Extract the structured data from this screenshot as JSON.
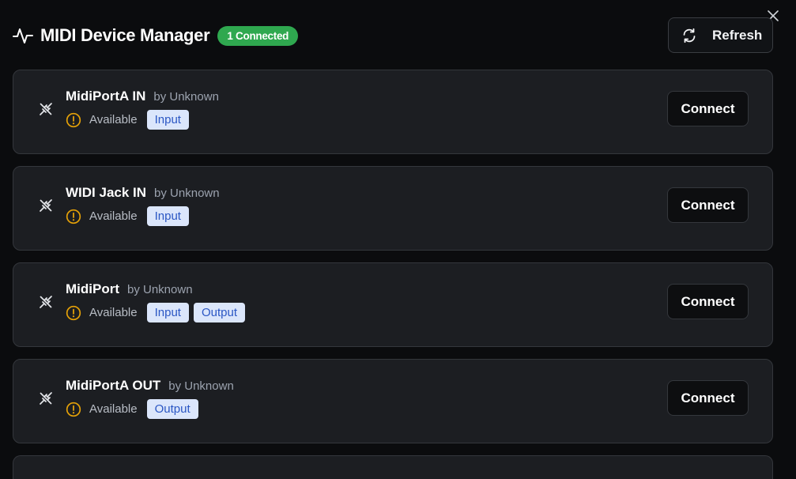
{
  "window": {
    "title": "MIDI Device Manager",
    "connected_badge": "1 Connected",
    "refresh_label": "Refresh",
    "close_icon": "close-icon",
    "title_icon": "activity-pulse-icon"
  },
  "colors": {
    "background": "#0b0c0e",
    "card": "#1c1e22",
    "badge_green": "#2fa84f",
    "warning": "#e3a008",
    "tag_bg": "#dbe6fb",
    "tag_text": "#2b57c4"
  },
  "devices": [
    {
      "name": "MidiPortA IN",
      "maker": "by Unknown",
      "status": "Available",
      "tags": [
        "Input"
      ],
      "action": "Connect",
      "icon": "unplugged-icon",
      "status_icon": "warning-circle-icon"
    },
    {
      "name": "WIDI Jack IN",
      "maker": "by Unknown",
      "status": "Available",
      "tags": [
        "Input"
      ],
      "action": "Connect",
      "icon": "unplugged-icon",
      "status_icon": "warning-circle-icon"
    },
    {
      "name": "MidiPort",
      "maker": "by Unknown",
      "status": "Available",
      "tags": [
        "Input",
        "Output"
      ],
      "action": "Connect",
      "icon": "unplugged-icon",
      "status_icon": "warning-circle-icon"
    },
    {
      "name": "MidiPortA OUT",
      "maker": "by Unknown",
      "status": "Available",
      "tags": [
        "Output"
      ],
      "action": "Connect",
      "icon": "unplugged-icon",
      "status_icon": "warning-circle-icon"
    }
  ]
}
